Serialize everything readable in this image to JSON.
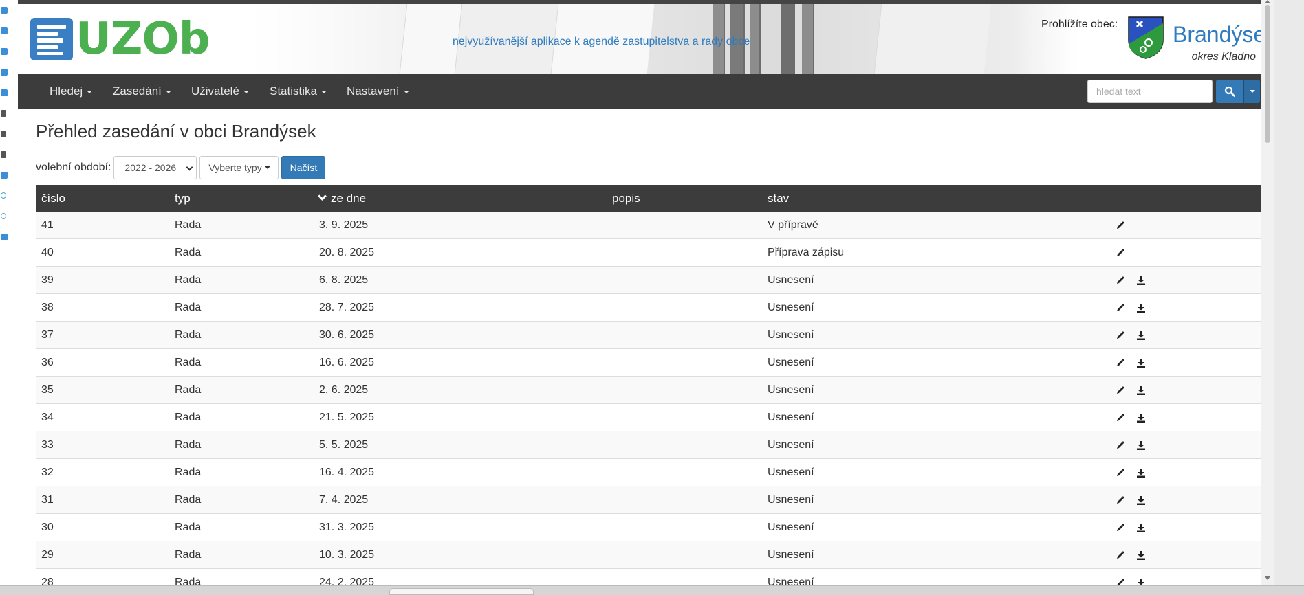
{
  "app": {
    "logo_text": "UZOb",
    "tagline": "nejvyužívanější aplikace k agendě zastupitelstva a rady obce"
  },
  "municipality": {
    "viewing_label": "Prohlížíte obec:",
    "name": "Brandýsek",
    "district": "okres Kladno"
  },
  "nav": {
    "items": [
      {
        "label": "Hledej"
      },
      {
        "label": "Zasedání"
      },
      {
        "label": "Uživatelé"
      },
      {
        "label": "Statistika"
      },
      {
        "label": "Nastavení"
      }
    ],
    "search_placeholder": "hledat text"
  },
  "page": {
    "title": "Přehled zasedání v obci Brandýsek"
  },
  "filters": {
    "period_label": "volební období:",
    "period_value": "2022 - 2026",
    "types_placeholder": "Vyberte typy",
    "load_button": "Načíst"
  },
  "table": {
    "headers": {
      "number": "číslo",
      "type": "typ",
      "date": "ze dne",
      "description": "popis",
      "status": "stav"
    },
    "rows": [
      {
        "number": "41",
        "type": "Rada",
        "date": "3. 9. 2025",
        "description": "",
        "status": "V přípravě",
        "download": false
      },
      {
        "number": "40",
        "type": "Rada",
        "date": "20. 8. 2025",
        "description": "",
        "status": "Příprava zápisu",
        "download": false
      },
      {
        "number": "39",
        "type": "Rada",
        "date": "6. 8. 2025",
        "description": "",
        "status": "Usnesení",
        "download": true
      },
      {
        "number": "38",
        "type": "Rada",
        "date": "28. 7. 2025",
        "description": "",
        "status": "Usnesení",
        "download": true
      },
      {
        "number": "37",
        "type": "Rada",
        "date": "30. 6. 2025",
        "description": "",
        "status": "Usnesení",
        "download": true
      },
      {
        "number": "36",
        "type": "Rada",
        "date": "16. 6. 2025",
        "description": "",
        "status": "Usnesení",
        "download": true
      },
      {
        "number": "35",
        "type": "Rada",
        "date": "2. 6. 2025",
        "description": "",
        "status": "Usnesení",
        "download": true
      },
      {
        "number": "34",
        "type": "Rada",
        "date": "21. 5. 2025",
        "description": "",
        "status": "Usnesení",
        "download": true
      },
      {
        "number": "33",
        "type": "Rada",
        "date": "5. 5. 2025",
        "description": "",
        "status": "Usnesení",
        "download": true
      },
      {
        "number": "32",
        "type": "Rada",
        "date": "16. 4. 2025",
        "description": "",
        "status": "Usnesení",
        "download": true
      },
      {
        "number": "31",
        "type": "Rada",
        "date": "7. 4. 2025",
        "description": "",
        "status": "Usnesení",
        "download": true
      },
      {
        "number": "30",
        "type": "Rada",
        "date": "31. 3. 2025",
        "description": "",
        "status": "Usnesení",
        "download": true
      },
      {
        "number": "29",
        "type": "Rada",
        "date": "10. 3. 2025",
        "description": "",
        "status": "Usnesení",
        "download": true
      },
      {
        "number": "28",
        "type": "Rada",
        "date": "24. 2. 2025",
        "description": "",
        "status": "Usnesení",
        "download": true
      }
    ]
  },
  "icons": {
    "edit": "pencil-icon",
    "download": "download-icon",
    "search": "search-icon",
    "sort": "sort-desc-icon"
  },
  "colors": {
    "primary": "#337ab7",
    "logo_green": "#4caf50",
    "navbar": "#3c3c3c",
    "link": "#2f7cc0"
  }
}
